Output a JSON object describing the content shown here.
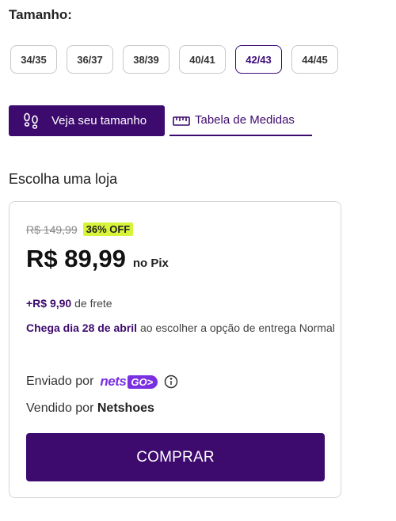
{
  "size": {
    "title": "Tamanho:",
    "options": [
      "34/35",
      "36/37",
      "38/39",
      "40/41",
      "42/43",
      "44/45"
    ],
    "selected": "42/43"
  },
  "tools": {
    "veja_label": "Veja seu tamanho",
    "tabela_label": "Tabela de Medidas"
  },
  "store": {
    "title": "Escolha uma loja"
  },
  "offer": {
    "old_price": "R$ 149,99",
    "discount_badge": "36% OFF",
    "price": "R$ 89,99",
    "price_method": "no Pix",
    "frete_value": "+R$ 9,90",
    "frete_text": "de frete",
    "delivery_strong": "Chega dia 28 de abril",
    "delivery_text": "ao escolher a opção de entrega Normal",
    "shipped_by_label": "Enviado por",
    "shipped_by_brand_text": "nets",
    "shipped_by_brand_box": "GO>",
    "sold_by_label": "Vendido por",
    "sold_by_value": "Netshoes",
    "buy_label": "COMPRAR"
  },
  "colors": {
    "brand_purple": "#3d0a6e",
    "netsgo_purple": "#7a2fe0",
    "discount_badge": "#d7f33a"
  },
  "icons": {
    "veja": "footprints-icon",
    "tabela": "ruler-icon",
    "info": "info-icon"
  }
}
